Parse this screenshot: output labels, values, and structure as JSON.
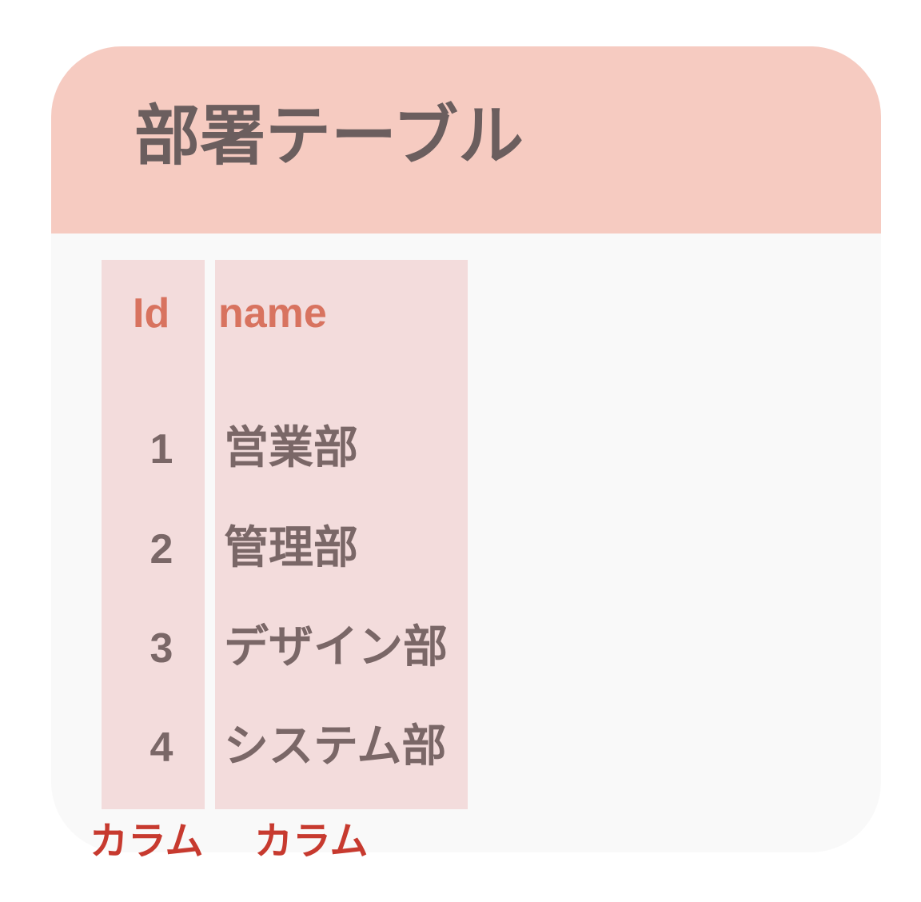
{
  "table": {
    "title": "部署テーブル",
    "columns": [
      {
        "header": "Id",
        "caption": "カラム"
      },
      {
        "header": "name",
        "caption": "カラム"
      }
    ],
    "rows": [
      {
        "id": "1",
        "name": "営業部"
      },
      {
        "id": "2",
        "name": "管理部"
      },
      {
        "id": "3",
        "name": "デザイン部"
      },
      {
        "id": "4",
        "name": "システム部"
      }
    ]
  },
  "colors": {
    "header_bg": "#f6cbc1",
    "card_bg": "#f9f9f9",
    "column_bg": "#f3dcdc",
    "title_text": "#6b5e5e",
    "column_header_text": "#d8735f",
    "cell_text": "#7a6767",
    "caption_text": "#c73a2f"
  }
}
